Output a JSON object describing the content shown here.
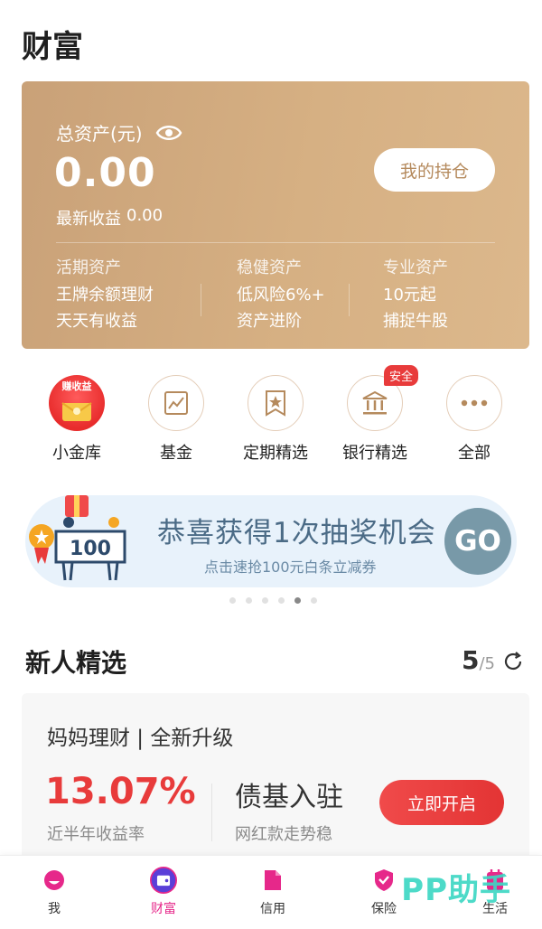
{
  "page": {
    "title": "财富"
  },
  "asset_card": {
    "label": "总资产(元)",
    "total": "0.00",
    "latest_income_label": "最新收益",
    "latest_income_value": "0.00",
    "holdings_button": "我的持仓",
    "columns": [
      {
        "title": "活期资产",
        "line1": "王牌余额理财",
        "line2": "天天有收益"
      },
      {
        "title": "稳健资产",
        "line1": "低风险6%+",
        "line2": "资产进阶"
      },
      {
        "title": "专业资产",
        "line1": "10元起",
        "line2": "捕捉牛股"
      }
    ]
  },
  "quick_entries": [
    {
      "label": "小金库",
      "icon": "vault-icon",
      "tag": "赚收益"
    },
    {
      "label": "基金",
      "icon": "chart-icon"
    },
    {
      "label": "定期精选",
      "icon": "star-bookmark-icon"
    },
    {
      "label": "银行精选",
      "icon": "bank-icon",
      "badge": "安全"
    },
    {
      "label": "全部",
      "icon": "more-icon"
    }
  ],
  "banner": {
    "title": "恭喜获得1次抽奖机会",
    "subtitle": "点击速抢100元白条立减券",
    "go_label": "GO",
    "sign_text": "100",
    "dots_total": 6,
    "dots_active": 4
  },
  "new_user": {
    "title": "新人精选",
    "current": "5",
    "total": "/5"
  },
  "product": {
    "name": "妈妈理财 | 全新升级",
    "rate": "13.07%",
    "rate_label": "近半年收益率",
    "headline": "债基入驻",
    "desc": "网红款走势稳",
    "button": "立即开启"
  },
  "tabbar": [
    {
      "label": "我",
      "icon": "profile-icon"
    },
    {
      "label": "财富",
      "icon": "wallet-icon",
      "active": true
    },
    {
      "label": "信用",
      "icon": "credit-icon"
    },
    {
      "label": "保险",
      "icon": "shield-icon"
    },
    {
      "label": "生活",
      "icon": "life-icon"
    }
  ],
  "watermark": "PP助手",
  "colors": {
    "accent_red": "#e83b3b",
    "gold_card": "#d6b083",
    "brand_pink": "#e6288a"
  }
}
